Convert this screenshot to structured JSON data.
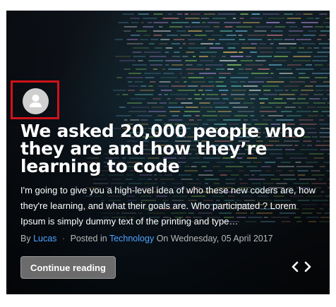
{
  "post": {
    "title": "We asked 20,000 people who they are and how they’re learning to code",
    "excerpt": " I'm going to give you a high-level idea of who these new coders are, how they're learning, and what their goals are. Who participated ? Lorem Ipsum is simply dummy text of the printing and type…",
    "meta": {
      "by_label": "By",
      "author": "Lucas",
      "separator": "·",
      "posted_in_label": "Posted in",
      "category": "Technology",
      "on_label": "On",
      "date": "Wednesday, 05 April 2017"
    },
    "read_more_label": "Continue reading"
  },
  "icons": {
    "avatar": "user-icon",
    "prev": "chevron-left-icon",
    "next": "chevron-right-icon"
  },
  "colors": {
    "highlight_border": "#d0121a",
    "link": "#4fa3ff",
    "button_bg": "#6b6b6b"
  }
}
